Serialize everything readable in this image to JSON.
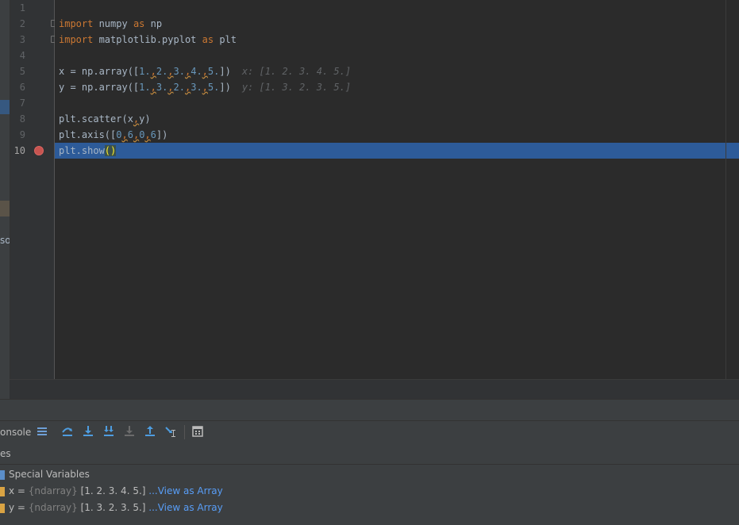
{
  "editor": {
    "line_numbers": [
      "1",
      "2",
      "3",
      "4",
      "5",
      "6",
      "7",
      "8",
      "9",
      "10"
    ],
    "current_line": "10",
    "lines": {
      "l2": {
        "kw1": "import",
        "mod": " numpy ",
        "kw2": "as",
        "alias": " np"
      },
      "l3": {
        "kw1": "import",
        "mod": " matplotlib.pyplot ",
        "kw2": "as",
        "alias": " plt"
      },
      "l5": {
        "lhs": "x = np.array([",
        "nums": [
          "1.",
          "2.",
          "3.",
          "4.",
          "5."
        ],
        "sep": ",",
        "end": "])",
        "inlay": "x: [1. 2. 3. 4. 5.]"
      },
      "l6": {
        "lhs": "y = np.array([",
        "nums": [
          "1.",
          "3.",
          "2.",
          "3.",
          "5."
        ],
        "sep": ",",
        "end": "])",
        "inlay": "y: [1. 3. 2. 3. 5.]"
      },
      "l8": {
        "pre": "plt.scatter(x",
        "sep": ",",
        "post": "y)"
      },
      "l9": {
        "pre": "plt.axis([",
        "nums": [
          "0",
          "6",
          "0",
          "6"
        ],
        "sep": ",",
        "end": "])"
      },
      "l10": {
        "pre": "plt.show",
        "paren": "()"
      }
    }
  },
  "left_strip": {
    "cut_label": "so"
  },
  "debug": {
    "console_tab": "onsole",
    "toolbar_icons": [
      "threads-icon",
      "step-over-icon",
      "step-into-icon",
      "step-into-my-code-icon",
      "force-step-into-icon",
      "step-out-icon",
      "run-to-cursor-icon",
      "evaluate-icon"
    ],
    "vars_tab": "es"
  },
  "variables": [
    {
      "label": "Special Variables",
      "kind": "group"
    },
    {
      "name": "x",
      "eq": " = ",
      "type": "{ndarray}",
      "value": " [1. 2. 3. 4. 5.]",
      "link": " ...View as Array"
    },
    {
      "name": "y",
      "eq": " = ",
      "type": "{ndarray}",
      "value": " [1. 3. 2. 3. 5.]",
      "link": " ...View as Array"
    }
  ],
  "colors": {
    "background": "#2b2b2b",
    "keyword": "#cc7832",
    "number": "#6897bb",
    "selection": "#2d5b99",
    "breakpoint": "#c75450",
    "link": "#589df6"
  }
}
